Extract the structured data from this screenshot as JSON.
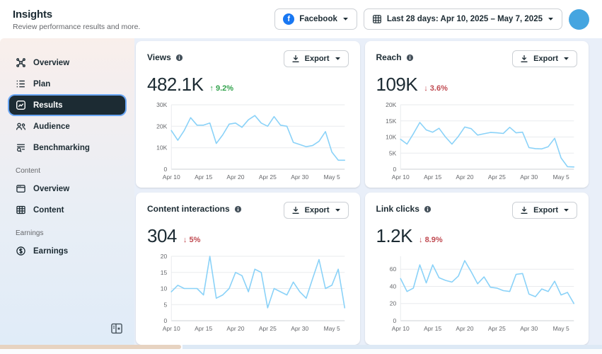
{
  "header": {
    "title": "Insights",
    "subtitle": "Review performance results and more.",
    "platform_selector": {
      "label": "Facebook",
      "icon": "facebook-icon"
    },
    "date_range": {
      "label": "Last 28 days: Apr 10, 2025 – May 7, 2025",
      "icon": "calendar-grid-icon"
    }
  },
  "sidebar": {
    "sections": [
      {
        "label": "",
        "items": [
          {
            "label": "Overview",
            "icon": "hub-icon",
            "active": false
          },
          {
            "label": "Plan",
            "icon": "checklist-icon",
            "active": false
          },
          {
            "label": "Results",
            "icon": "trend-chart-icon",
            "active": true
          },
          {
            "label": "Audience",
            "icon": "people-icon",
            "active": false
          },
          {
            "label": "Benchmarking",
            "icon": "lines-magnifier-icon",
            "active": false
          }
        ]
      },
      {
        "label": "Content",
        "items": [
          {
            "label": "Overview",
            "icon": "card-icon",
            "active": false
          },
          {
            "label": "Content",
            "icon": "grid-table-icon",
            "active": false
          }
        ]
      },
      {
        "label": "Earnings",
        "items": [
          {
            "label": "Earnings",
            "icon": "dollar-circle-icon",
            "active": false
          }
        ]
      }
    ]
  },
  "cards": [
    {
      "title": "Views",
      "export_label": "Export",
      "metric": "482.1K",
      "delta": {
        "arrow": "↑",
        "value": "9.2%",
        "direction": "up"
      }
    },
    {
      "title": "Reach",
      "export_label": "Export",
      "metric": "109K",
      "delta": {
        "arrow": "↓",
        "value": "3.6%",
        "direction": "down"
      }
    },
    {
      "title": "Content interactions",
      "export_label": "Export",
      "metric": "304",
      "delta": {
        "arrow": "↓",
        "value": "5%",
        "direction": "down"
      }
    },
    {
      "title": "Link clicks",
      "export_label": "Export",
      "metric": "1.2K",
      "delta": {
        "arrow": "↓",
        "value": "8.9%",
        "direction": "down"
      }
    }
  ],
  "chart_data": [
    {
      "type": "line",
      "title": "Views",
      "ylim": [
        0,
        30000
      ],
      "yticks": [
        {
          "v": 0,
          "label": "0"
        },
        {
          "v": 10,
          "label": "10K"
        },
        {
          "v": 20,
          "label": "20K"
        },
        {
          "v": 30,
          "label": "30K"
        }
      ],
      "ymax": 30,
      "xticks": [
        {
          "i": 0,
          "label": "Apr 10"
        },
        {
          "i": 5,
          "label": "Apr 15"
        },
        {
          "i": 10,
          "label": "Apr 20"
        },
        {
          "i": 15,
          "label": "Apr 25"
        },
        {
          "i": 20,
          "label": "Apr 30"
        },
        {
          "i": 25,
          "label": "May 5"
        }
      ],
      "values": [
        18,
        13.5,
        18,
        24,
        20.5,
        20.5,
        21.5,
        12,
        16,
        21,
        21.5,
        19.5,
        23,
        25,
        21.5,
        20,
        24.5,
        20.5,
        20,
        12.5,
        11.5,
        10.5,
        11,
        13,
        17.5,
        8,
        4.2,
        4.2
      ],
      "unit": "K"
    },
    {
      "type": "line",
      "title": "Reach",
      "ylim": [
        0,
        20000
      ],
      "yticks": [
        {
          "v": 0,
          "label": "0"
        },
        {
          "v": 5,
          "label": "5K"
        },
        {
          "v": 10,
          "label": "10K"
        },
        {
          "v": 15,
          "label": "15K"
        },
        {
          "v": 20,
          "label": "20K"
        }
      ],
      "ymax": 20,
      "xticks": [
        {
          "i": 0,
          "label": "Apr 10"
        },
        {
          "i": 5,
          "label": "Apr 15"
        },
        {
          "i": 10,
          "label": "Apr 20"
        },
        {
          "i": 15,
          "label": "Apr 25"
        },
        {
          "i": 20,
          "label": "Apr 30"
        },
        {
          "i": 25,
          "label": "May 5"
        }
      ],
      "values": [
        9.3,
        7.8,
        11,
        14.5,
        12.2,
        11.5,
        12.7,
        10,
        7.8,
        10.2,
        13.1,
        12.6,
        10.6,
        11,
        11.4,
        11.3,
        11.1,
        13,
        11.3,
        11.5,
        6.7,
        6.4,
        6.3,
        7,
        9.6,
        3.5,
        0.8,
        0.7
      ],
      "unit": "K"
    },
    {
      "type": "line",
      "title": "Content interactions",
      "ylim": [
        0,
        20
      ],
      "yticks": [
        {
          "v": 0,
          "label": "0"
        },
        {
          "v": 5,
          "label": "5"
        },
        {
          "v": 10,
          "label": "10"
        },
        {
          "v": 15,
          "label": "15"
        },
        {
          "v": 20,
          "label": "20"
        }
      ],
      "ymax": 20,
      "xticks": [
        {
          "i": 0,
          "label": "Apr 10"
        },
        {
          "i": 5,
          "label": "Apr 15"
        },
        {
          "i": 10,
          "label": "Apr 20"
        },
        {
          "i": 15,
          "label": "Apr 25"
        },
        {
          "i": 20,
          "label": "Apr 30"
        },
        {
          "i": 25,
          "label": "May 5"
        }
      ],
      "values": [
        9,
        11,
        10,
        10,
        10,
        8,
        20,
        7,
        8,
        10,
        15,
        14,
        9,
        16,
        15,
        4,
        10,
        9,
        8,
        12,
        9,
        7,
        13,
        19,
        10,
        11,
        16,
        4
      ],
      "unit": ""
    },
    {
      "type": "line",
      "title": "Link clicks",
      "ylim": [
        0,
        75
      ],
      "yticks": [
        {
          "v": 0,
          "label": "0"
        },
        {
          "v": 20,
          "label": "20"
        },
        {
          "v": 40,
          "label": "40"
        },
        {
          "v": 60,
          "label": "60"
        }
      ],
      "ymax": 75,
      "xticks": [
        {
          "i": 0,
          "label": "Apr 10"
        },
        {
          "i": 5,
          "label": "Apr 15"
        },
        {
          "i": 10,
          "label": "Apr 20"
        },
        {
          "i": 15,
          "label": "Apr 25"
        },
        {
          "i": 20,
          "label": "Apr 30"
        },
        {
          "i": 25,
          "label": "May 5"
        }
      ],
      "values": [
        49,
        34,
        38,
        65,
        44,
        65,
        50,
        47,
        45,
        52,
        70,
        57,
        43,
        51,
        39,
        38,
        35,
        34,
        54,
        55,
        31,
        28,
        37,
        34,
        46,
        30,
        33,
        20
      ],
      "unit": ""
    }
  ],
  "colors": {
    "accent_blue": "#1877f2",
    "chart_line": "#8ad2f8",
    "grid_line": "#e9ebee",
    "axis_line": "#ced0d4",
    "tick_text": "#65676b",
    "positive": "#31a24c",
    "negative": "#c04a51",
    "nav_active_bg": "#1c2b33",
    "avatar": "#45a5e0"
  }
}
